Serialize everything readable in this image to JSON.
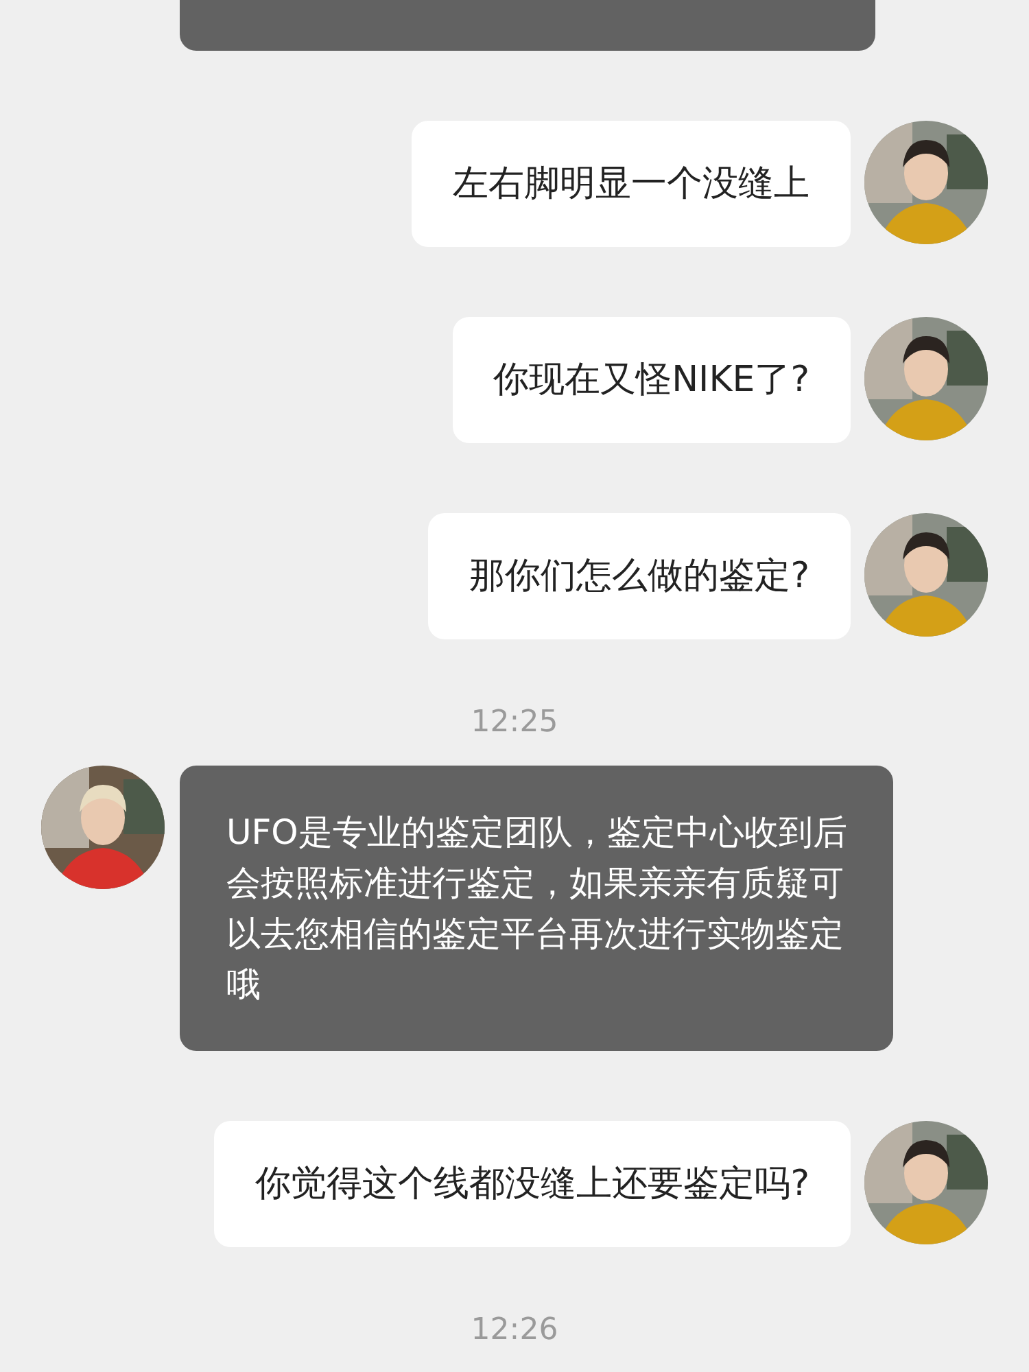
{
  "messages": [
    {
      "kind": "received_cut"
    },
    {
      "kind": "sent",
      "text": "左右脚明显一个没缝上"
    },
    {
      "kind": "sent",
      "text": "你现在又怪NIKE了?"
    },
    {
      "kind": "sent",
      "text": "那你们怎么做的鉴定?"
    },
    {
      "kind": "time",
      "text": "12:25"
    },
    {
      "kind": "received",
      "text": "UFO是专业的鉴定团队，鉴定中心收到后会按照标准进行鉴定，如果亲亲有质疑可以去您相信的鉴定平台再次进行实物鉴定哦"
    },
    {
      "kind": "sent",
      "text": "你觉得这个线都没缝上还要鉴定吗?"
    },
    {
      "kind": "time",
      "text": "12:26"
    }
  ]
}
